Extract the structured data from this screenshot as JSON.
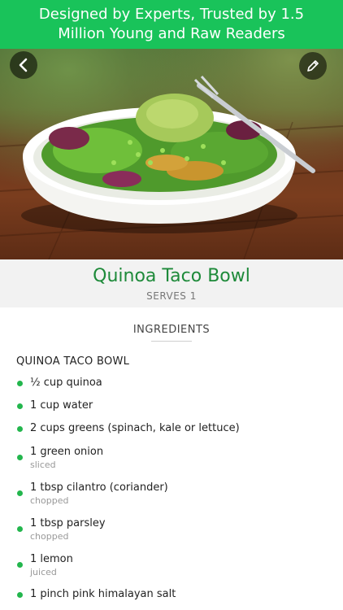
{
  "banner": {
    "text": "Designed by Experts, Trusted by 1.5 Million Young and Raw Readers",
    "color": "#19c35a"
  },
  "header": {
    "back_icon": "chevron-left-icon",
    "edit_icon": "pencil-icon"
  },
  "hero": {
    "image_description_icon": "salad-bowl-photo"
  },
  "recipe": {
    "title": "Quinoa Taco Bowl",
    "serves": "SERVES 1",
    "title_color": "#1e8a3a"
  },
  "ingredients": {
    "heading": "INGREDIENTS",
    "group_title": "QUINOA TACO BOWL",
    "bullet_color": "#23b64d",
    "items": [
      {
        "text": "½ cup quinoa",
        "note": ""
      },
      {
        "text": "1 cup water",
        "note": ""
      },
      {
        "text": "2 cups greens (spinach, kale or lettuce)",
        "note": ""
      },
      {
        "text": "1 green onion",
        "note": "sliced"
      },
      {
        "text": "1 tbsp cilantro (coriander)",
        "note": "chopped"
      },
      {
        "text": "1 tbsp parsley",
        "note": "chopped"
      },
      {
        "text": "1 lemon",
        "note": "juiced"
      },
      {
        "text": "1 pinch pink himalayan salt",
        "note": ""
      }
    ]
  }
}
